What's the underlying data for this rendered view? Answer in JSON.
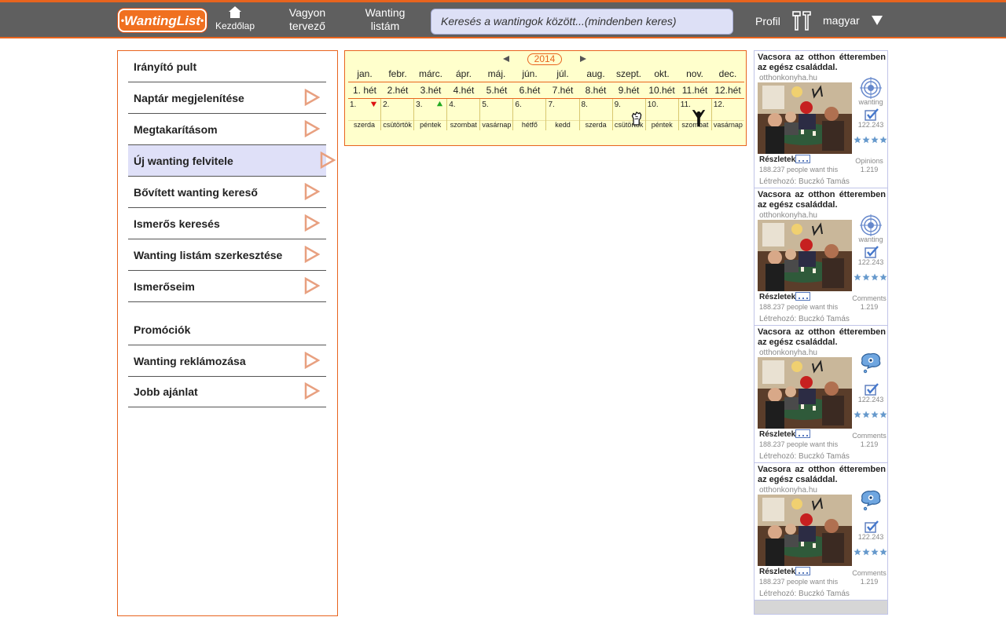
{
  "header": {
    "logo": "WantingList",
    "nav": {
      "home": "Kezdőlap",
      "planner_line1": "Vagyon",
      "planner_line2": "tervező",
      "list_line1": "Wanting",
      "list_line2": "listám"
    },
    "search_placeholder": "Keresés a wantingok között...(mindenben keres)",
    "profile": "Profil",
    "language": "magyar",
    "icons": {
      "home": "house-icon",
      "tools": "tools-icon",
      "language": "chevron-down-icon"
    },
    "colors": {
      "bar": "#5f5f5f",
      "accent": "#e8641e"
    }
  },
  "menu": {
    "items": [
      {
        "label": "Irányító pult"
      },
      {
        "label": "Naptár megjelenítése"
      },
      {
        "label": "Megtakarításom"
      },
      {
        "label": "Új wanting felvitele",
        "selected": true
      },
      {
        "label": "Bővített wanting kereső"
      },
      {
        "label": "Ismerős keresés"
      },
      {
        "label": "Wanting listám szerkesztése"
      },
      {
        "label": "Ismerőseim"
      }
    ],
    "promo_heading": "Promóciók",
    "promo_items": [
      {
        "label": "Wanting reklámozása"
      },
      {
        "label": "Jobb ajánlat"
      }
    ]
  },
  "calendar": {
    "year": "2014",
    "months": [
      "jan.",
      "febr.",
      "márc.",
      "ápr.",
      "máj.",
      "jún.",
      "júl.",
      "aug.",
      "szept.",
      "okt.",
      "nov.",
      "dec."
    ],
    "weeks": [
      "1. hét",
      "2.hét",
      "3.hét",
      "4.hét",
      "5.hét",
      "6.hét",
      "7.hét",
      "8.hét",
      "9.hét",
      "10.hét",
      "11.hét",
      "12.hét"
    ],
    "days": [
      "1.",
      "2.",
      "3.",
      "4.",
      "5.",
      "6.",
      "7.",
      "8.",
      "9.",
      "10.",
      "11.",
      "12."
    ],
    "daynames": [
      "szerda",
      "csütörtök",
      "péntek",
      "szombat",
      "vasárnap",
      "hétfő",
      "kedd",
      "szerda",
      "csütörtök",
      "péntek",
      "szombat",
      "vasárnap"
    ],
    "markers": {
      "down": "red-down-arrow-icon",
      "up": "green-up-arrow-icon",
      "fist": "raised-fist-icon",
      "cheer": "cheering-person-icon"
    }
  },
  "feed": {
    "cards": [
      {
        "title": "Vacsora az otthon étteremben az egész családdal.",
        "source": "otthonkonyha.hu",
        "icon_label": "wanting",
        "count": "122.243",
        "details": "Részletek",
        "want": "188.237 people want this",
        "op_label": "Opinions",
        "op_count": "1.219",
        "author": "Létrehozó: Buczkó Tamás",
        "icon": "target-icon"
      },
      {
        "title": "Vacsora az otthon étteremben az egész családdal.",
        "source": "otthonkonyha.hu",
        "icon_label": "wanting",
        "count": "122.243",
        "details": "Részletek",
        "want": "188.237 people want this",
        "op_label": "Comments",
        "op_count": "1.219",
        "author": "Létrehozó: Buczkó Tamás",
        "icon": "target-icon"
      },
      {
        "title": "Vacsora az otthon étteremben az egész családdal.",
        "source": "otthonkonyha.hu",
        "icon_label": "",
        "count": "122.243",
        "details": "Részletek",
        "want": "188.237 people want this",
        "op_label": "Comments",
        "op_count": "1.219",
        "author": "Létrehozó: Buczkó Tamás",
        "icon": "thought-bubble-icon"
      },
      {
        "title": "Vacsora az otthon étteremben az egész családdal.",
        "source": "otthonkonyha.hu",
        "icon_label": "",
        "count": "122.243",
        "details": "Részletek",
        "want": "188.237 people want this",
        "op_label": "Comments",
        "op_count": "1.219",
        "author": "Létrehozó: Buczkó Tamás",
        "icon": "thought-bubble-icon"
      }
    ],
    "rating": 4
  }
}
